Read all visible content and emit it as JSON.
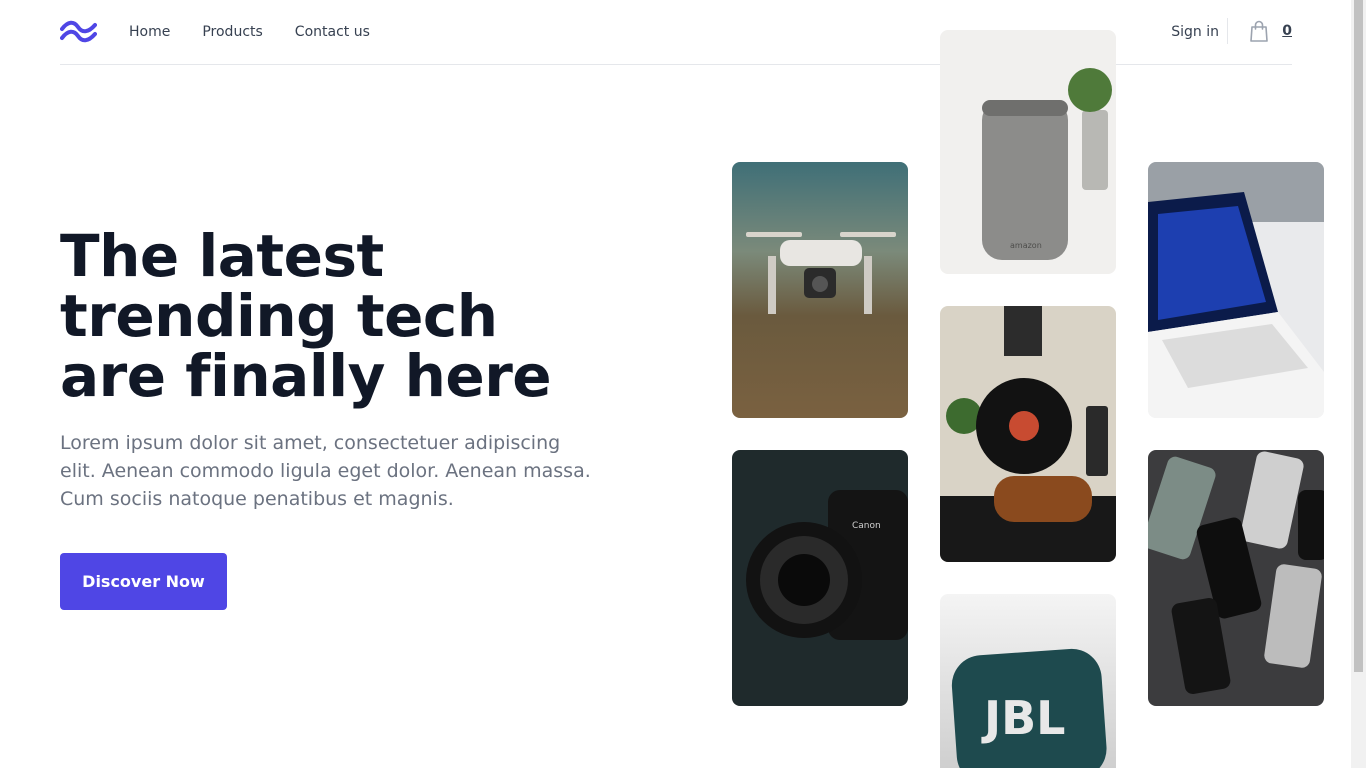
{
  "nav": {
    "home": "Home",
    "products": "Products",
    "contact": "Contact us"
  },
  "header": {
    "sign_in": "Sign in",
    "cart_count": "0"
  },
  "hero": {
    "title": "The latest trending tech are finally here",
    "description": "Lorem ipsum dolor sit amet, consectetuer adipiscing elit. Aenean commodo ligula eget dolor. Aenean massa. Cum sociis natoque penatibus et magnis.",
    "cta_label": "Discover Now"
  },
  "gallery": {
    "speaker_brand": "amazon",
    "jbl_brand": "JBL",
    "camera_brand": "Canon"
  },
  "colors": {
    "accent": "#4f46e5",
    "text_dark": "#111827",
    "text_muted": "#6b7280"
  }
}
